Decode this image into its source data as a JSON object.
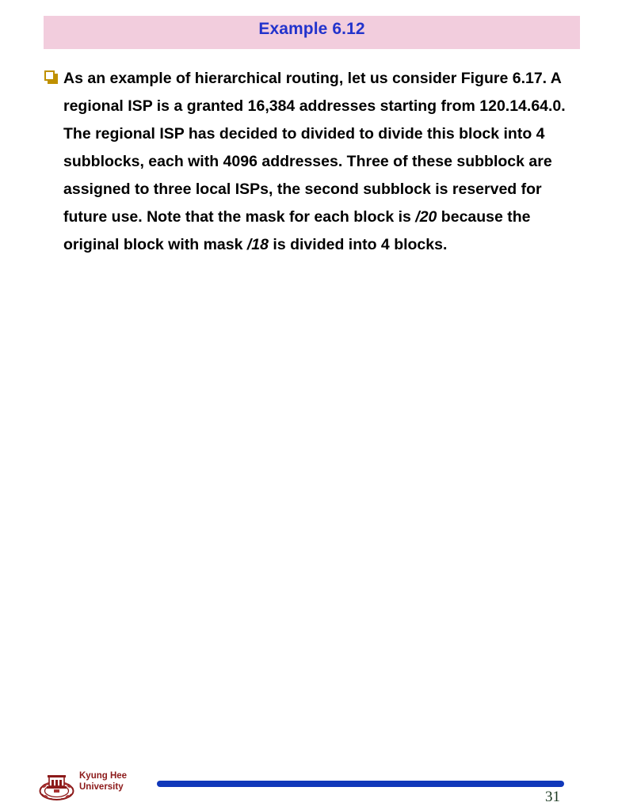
{
  "slide": {
    "title": "Example 6.12",
    "title_band_color": "#f2cddd",
    "title_text_color": "#2233cc",
    "bullet_icon": "square-bullet-icon",
    "bullet_color": "#bf9000",
    "body_lines": [
      "As an example of hierarchical routing, let us consider",
      "Figure 6.17. A regional ISP is a granted 16,384",
      "addresses starting from 120.14.64.0. The regional ISP",
      "has decided to divided to divide this block into 4",
      "subblocks, each with 4096 addresses. Three of these",
      "subblock are assigned to three local ISPs, the second",
      "subblock is reserved for future use. Note that the mask",
      "for each block is /20 because the original block with",
      "mask /18 is divided into 4 blocks."
    ],
    "body_text_prefix": "As an example of hierarchical routing, let us consider Figure 6.17. A regional ISP is a granted 16,384 addresses starting from 120.14.64.0. The regional ISP has decided to divided to divide this block into 4 subblocks, each with 4096 addresses. Three of these subblock are assigned to three local ISPs, the second subblock is reserved for future use. Note that the mask for each block is ",
    "mask_slash_20": "/20",
    "body_text_middle": " because the original block with mask ",
    "mask_slash_18": "/18",
    "body_text_suffix": " is divided into 4 blocks."
  },
  "footer": {
    "logo_icon": "university-crest-icon",
    "university_line1": "Kyung Hee",
    "university_line2": "University",
    "university_color": "#8c1a1a",
    "rule_color": "#1038ba",
    "page_number": "31",
    "page_number_color": "#1c3a22"
  }
}
